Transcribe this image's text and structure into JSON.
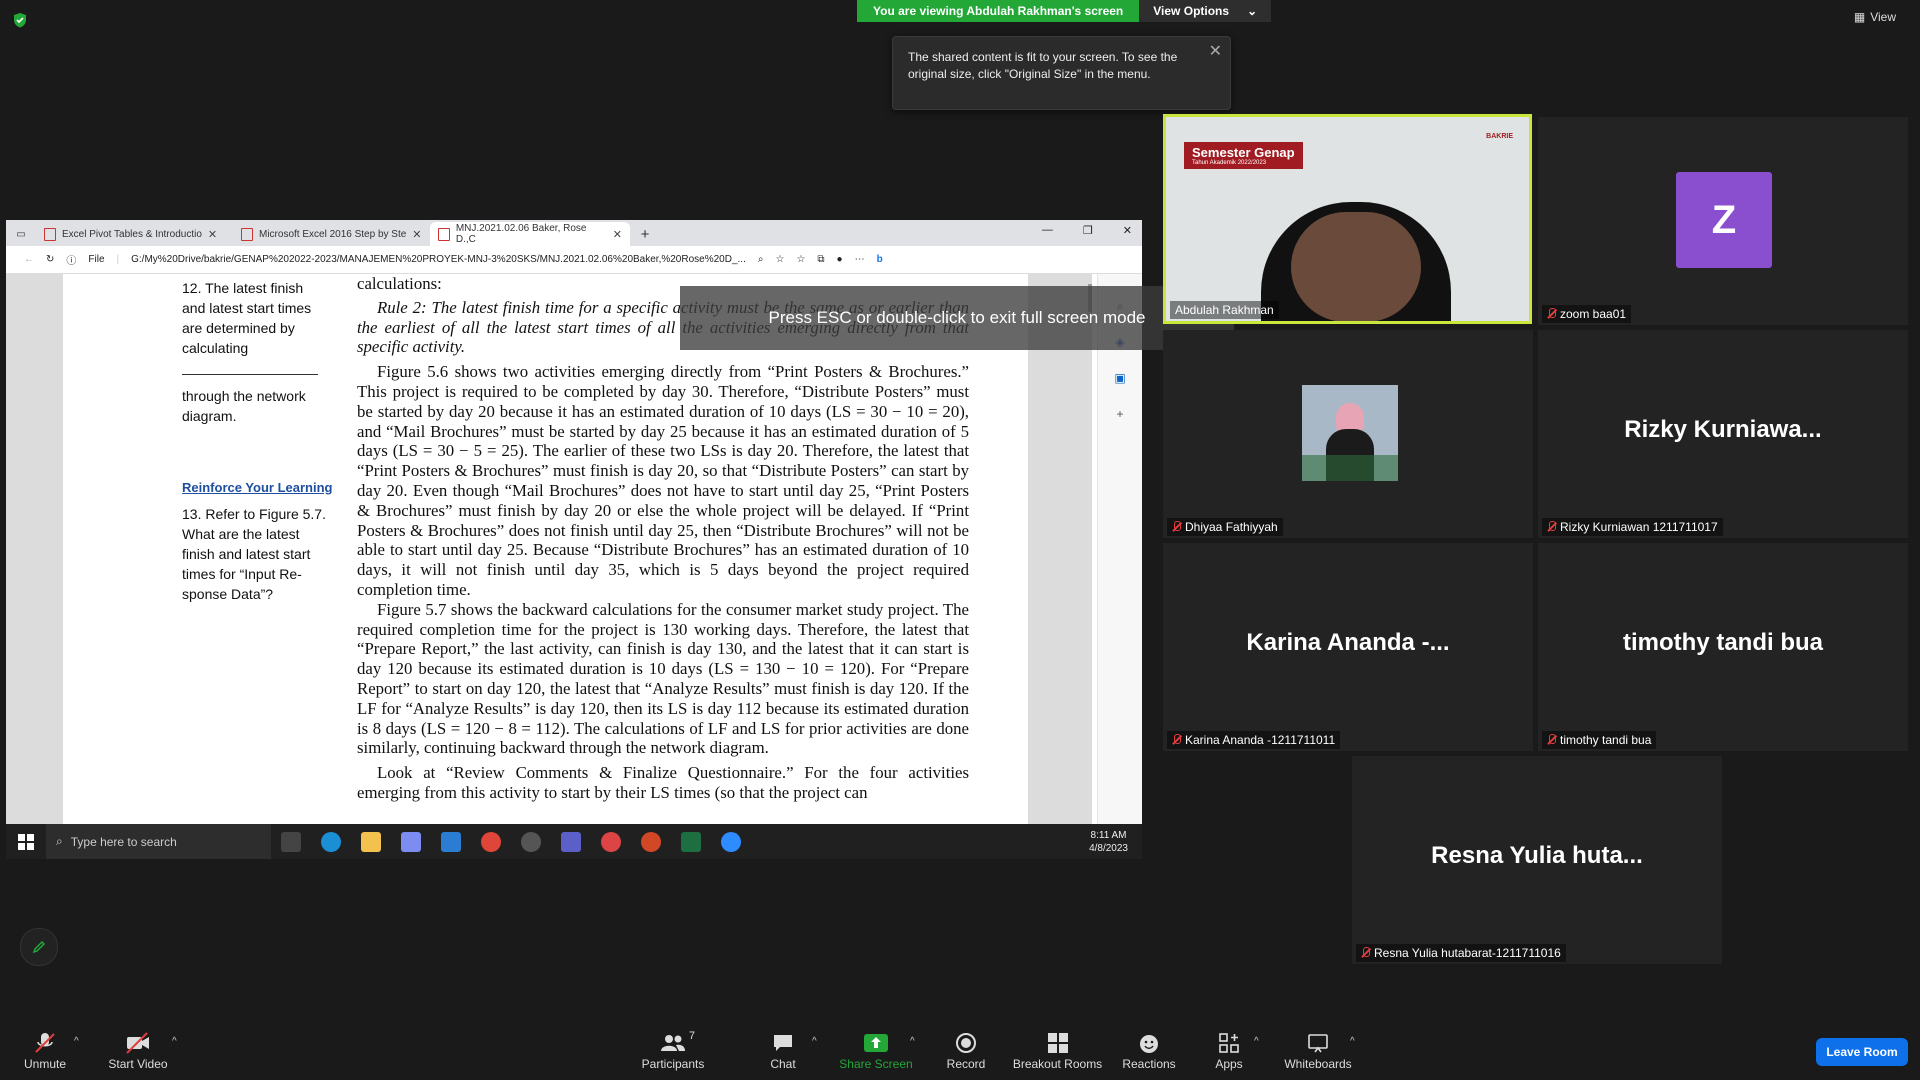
{
  "banner": {
    "viewing": "You are viewing Abdulah Rakhman's screen",
    "view_options": "View Options"
  },
  "view_top": "View",
  "tooltip": {
    "text": "The shared content is fit to your screen. To see the original size, click \"Original Size\" in the menu."
  },
  "browser": {
    "tabs": [
      "Excel Pivot Tables & Introductio",
      "Microsoft Excel 2016 Step by Ste",
      "MNJ.2021.02.06 Baker, Rose D.,C"
    ],
    "file_label": "File",
    "url": "G:/My%20Drive/bakrie/GENAP%202022-2023/MANAJEMEN%20PROYEK-MNJ-3%20SKS/MNJ.2021.02.06%20Baker,%20Rose%20D_..."
  },
  "pdf": {
    "margin_top": [
      "12. The latest finish",
      "and latest start times",
      "are determined by",
      "calculating"
    ],
    "margin_mid": [
      "through the network",
      "diagram."
    ],
    "reinforce": "Reinforce Your Learning",
    "margin_q": [
      "13. Refer to Figure 5.7.",
      "What are the latest",
      "finish and latest start",
      "times for “Input Re-",
      "sponse Data”?"
    ],
    "p0": "calculations:",
    "p1": "Rule 2: The latest finish time for a specific activity must be the same as or earlier than the earliest of all the latest start times of all the activities emerging directly from that specific activity.",
    "p2": "Figure 5.6 shows two activities emerging directly from “Print Posters & Brochures.” This project is required to be completed by day 30. Therefore, “Distribute Posters” must be started by day 20 because it has an estimated duration of 10 days (LS = 30 − 10 = 20), and “Mail Brochures” must be started by day 25 because it has an estimated duration of 5 days (LS = 30 − 5 = 25). The earlier of these two LSs is day 20. Therefore, the latest that “Print Posters & Brochures” must finish is day 20, so that “Distribute Posters” can start by day 20. Even though “Mail Brochures” does not have to start until day 25, “Print Posters & Brochures” must finish by day 20 or else the whole project will be delayed. If “Print Posters & Brochures” does not finish until day 25, then “Distribute Brochures” will not be able to start until day 25. Because “Distribute Brochures” has an estimated duration of 10 days, it will not finish until day 35, which is 5 days beyond the project required completion time.",
    "p3": "Figure 5.7 shows the backward calculations for the consumer market study project. The required completion time for the project is 130 working days. Therefore, the latest that “Prepare Report,” the last activity, can finish is day 130, and the latest that it can start is day 120 because its estimated duration is 10 days (LS = 130 − 10 = 120). For “Prepare Report” to start on day 120, the latest that “Analyze Results” must finish is day 120. If the LF for “Analyze Results” is day 120, then its LS is day 112 because its estimated duration is 8 days (LS = 120 − 8 = 112). The calculations of LF and LS for prior activities are done similarly, continuing backward through the network diagram.",
    "p4": "Look at “Review Comments & Finalize Questionnaire.” For the four activities emerging from this activity to start by their LS times (so that the project can"
  },
  "esc_message": "Press ESC or double-click to exit full screen mode",
  "taskbar": {
    "search": "Type here to search",
    "time": "8:11 AM",
    "date": "4/8/2023"
  },
  "slide": {
    "title": "Semester Genap",
    "subtitle": "Tahun Akademik 2022/2023",
    "logo": "BAKRIE"
  },
  "participants": {
    "speaker": "Abdulah Rakhman",
    "zoom": {
      "avatar": "Z",
      "name": "zoom baa01"
    },
    "dhiyaa": "Dhiyaa Fathiyyah",
    "rizky": {
      "big": "Rizky  Kurniawa...",
      "name": "Rizky Kurniawan 1211711017"
    },
    "karina": {
      "big": "Karina Ananda -...",
      "name": "Karina Ananda -1211711011"
    },
    "timothy": {
      "big": "timothy tandi bua",
      "name": "timothy tandi bua"
    },
    "resna": {
      "big": "Resna Yulia huta...",
      "name": "Resna Yulia hutabarat-1211711016"
    }
  },
  "toolbar": {
    "unmute": "Unmute",
    "start_video": "Start Video",
    "participants": "Participants",
    "participant_count": "7",
    "chat": "Chat",
    "share_screen": "Share Screen",
    "record": "Record",
    "breakout": "Breakout Rooms",
    "reactions": "Reactions",
    "apps": "Apps",
    "whiteboards": "Whiteboards",
    "leave": "Leave Room"
  },
  "colors": {
    "share_green": "#23a838",
    "leave_blue": "#0e71eb",
    "speaker_border": "#c8e63c",
    "avatar_purple": "#8a4fcf",
    "mute_red": "#e03e3e"
  }
}
